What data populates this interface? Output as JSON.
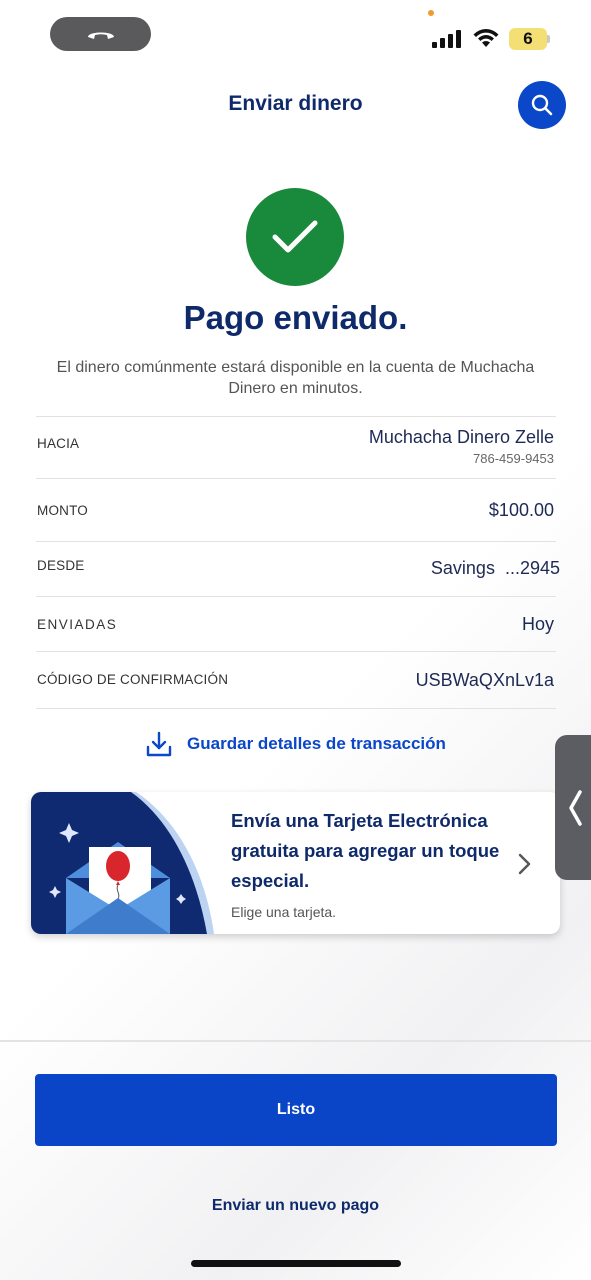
{
  "status_bar": {
    "battery_level": "6",
    "icons": [
      "phone-call-icon",
      "signal-icon",
      "wifi-icon",
      "battery-icon"
    ]
  },
  "header": {
    "title": "Enviar dinero",
    "search_icon": "search-icon"
  },
  "success": {
    "icon": "check-icon",
    "title": "Pago enviado.",
    "message": "El dinero comúnmente estará disponible en la cuenta de Muchacha Dinero en minutos."
  },
  "details": {
    "to_label": "HACIA",
    "to_name": "Muchacha Dinero Zelle",
    "to_phone": "786-459-9453",
    "amount_label": "MONTO",
    "amount_value": "$100.00",
    "from_label": "DESDE",
    "from_value": "Savings  ...2945",
    "sent_label": "ENVIADAS",
    "sent_value": "Hoy",
    "confirmation_label": "CÓDIGO DE CONFIRMACIÓN",
    "confirmation_value": "USBWaQXnLv1a"
  },
  "save_details": {
    "label": "Guardar detalles de transacción",
    "icon": "download-icon"
  },
  "ecard": {
    "text": "Envía una Tarjeta Electrónica gratuita para agregar un toque especial.",
    "subtext": "Elige una tarjeta.",
    "icon": "chevron-right-icon"
  },
  "buttons": {
    "done": "Listo",
    "new_payment": "Enviar un nuevo pago"
  },
  "colors": {
    "primary_blue": "#0a45c8",
    "navy": "#0f2a6b",
    "success_green": "#198a3b"
  }
}
